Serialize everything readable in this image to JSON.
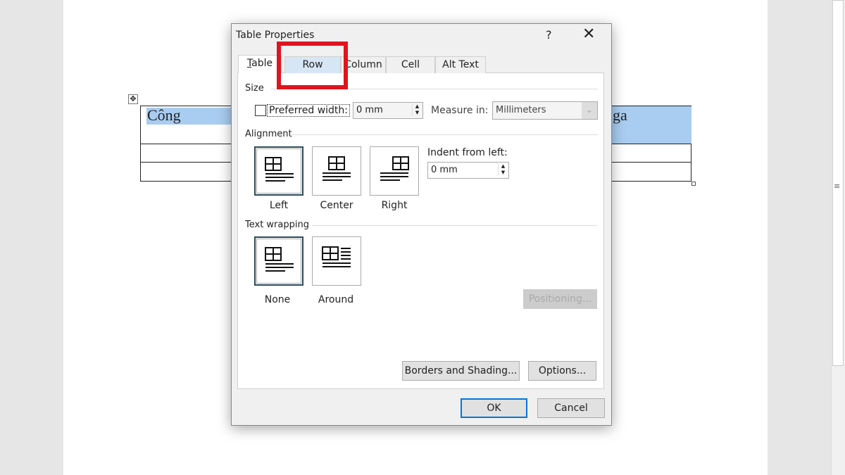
{
  "document": {
    "cell_left": "Công",
    "cell_right": "ga"
  },
  "dialog": {
    "title": "Table Properties",
    "help": "?",
    "close": "✕",
    "tabs": [
      {
        "label": "Table"
      },
      {
        "label": "Row"
      },
      {
        "label": "Column"
      },
      {
        "label": "Cell"
      },
      {
        "label": "Alt Text"
      }
    ],
    "active_tab": "Table",
    "highlighted_tab": "Row",
    "highlight_color": "#e0141e",
    "size": {
      "heading": "Size",
      "preferred_width_label": "Preferred width:",
      "preferred_width_checked": false,
      "preferred_width_value": "0 mm",
      "measure_label": "Measure in:",
      "measure_value": "Millimeters"
    },
    "alignment": {
      "heading": "Alignment",
      "options": [
        {
          "label": "Left",
          "selected": true
        },
        {
          "label": "Center",
          "selected": false
        },
        {
          "label": "Right",
          "selected": false
        }
      ],
      "indent_label": "Indent from left:",
      "indent_value": "0 mm"
    },
    "wrapping": {
      "heading": "Text wrapping",
      "options": [
        {
          "label": "None",
          "selected": true
        },
        {
          "label": "Around",
          "selected": false
        }
      ],
      "positioning_label": "Positioning..."
    },
    "borders_label": "Borders and Shading...",
    "options_label": "Options...",
    "ok_label": "OK",
    "cancel_label": "Cancel"
  }
}
